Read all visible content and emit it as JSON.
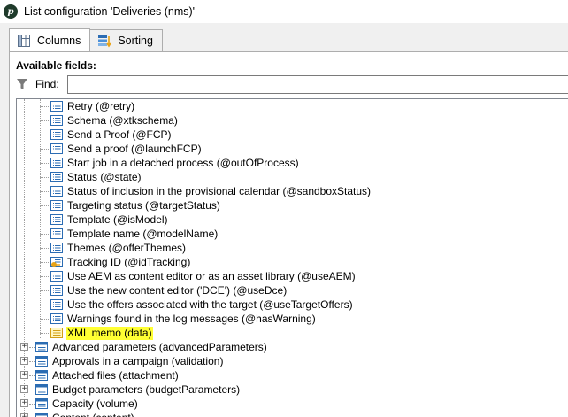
{
  "window": {
    "title": "List configuration 'Deliveries (nms)'"
  },
  "tabs": [
    {
      "label": "Columns",
      "icon": "columns-grid-icon"
    },
    {
      "label": "Sorting",
      "icon": "sorting-stack-icon"
    }
  ],
  "available_fields_label": "Available fields:",
  "find": {
    "label": "Find:",
    "value": ""
  },
  "tree": {
    "leaf_items": [
      {
        "label": "Retry (@retry)",
        "icon": "attribute-list-icon"
      },
      {
        "label": "Schema (@xtkschema)",
        "icon": "attribute-list-icon"
      },
      {
        "label": "Send a Proof (@FCP)",
        "icon": "attribute-list-icon"
      },
      {
        "label": "Send a proof (@launchFCP)",
        "icon": "attribute-list-icon"
      },
      {
        "label": "Start job in a detached process (@outOfProcess)",
        "icon": "attribute-list-icon"
      },
      {
        "label": "Status (@state)",
        "icon": "attribute-list-icon"
      },
      {
        "label": "Status of inclusion in the provisional calendar (@sandboxStatus)",
        "icon": "attribute-list-icon"
      },
      {
        "label": "Targeting status (@targetStatus)",
        "icon": "attribute-list-icon"
      },
      {
        "label": "Template (@isModel)",
        "icon": "attribute-list-icon"
      },
      {
        "label": "Template name (@modelName)",
        "icon": "attribute-list-icon"
      },
      {
        "label": "Themes (@offerThemes)",
        "icon": "attribute-list-icon"
      },
      {
        "label": "Tracking ID (@idTracking)",
        "icon": "attribute-key-icon"
      },
      {
        "label": "Use AEM as content editor or as an asset library (@useAEM)",
        "icon": "attribute-list-icon"
      },
      {
        "label": "Use the new content editor ('DCE') (@useDce)",
        "icon": "attribute-list-icon"
      },
      {
        "label": "Use the offers associated with the target (@useTargetOffers)",
        "icon": "attribute-list-icon"
      },
      {
        "label": "Warnings found in the  log messages (@hasWarning)",
        "icon": "attribute-list-icon"
      },
      {
        "label": "XML memo (data)",
        "icon": "memo-list-icon",
        "highlighted": true
      }
    ],
    "node_items": [
      {
        "label": "Advanced parameters (advancedParameters)",
        "icon": "element-node-icon"
      },
      {
        "label": "Approvals in a campaign (validation)",
        "icon": "element-node-icon"
      },
      {
        "label": "Attached files (attachment)",
        "icon": "element-node-icon"
      },
      {
        "label": "Budget parameters (budgetParameters)",
        "icon": "element-node-icon"
      },
      {
        "label": "Capacity (volume)",
        "icon": "element-node-icon"
      },
      {
        "label": "Content (content)",
        "icon": "element-node-icon"
      }
    ],
    "expander_symbol": "+"
  },
  "colors": {
    "highlight": "#ffff33",
    "icon_blue": "#2b6cb3",
    "icon_key": "#e8a317"
  }
}
